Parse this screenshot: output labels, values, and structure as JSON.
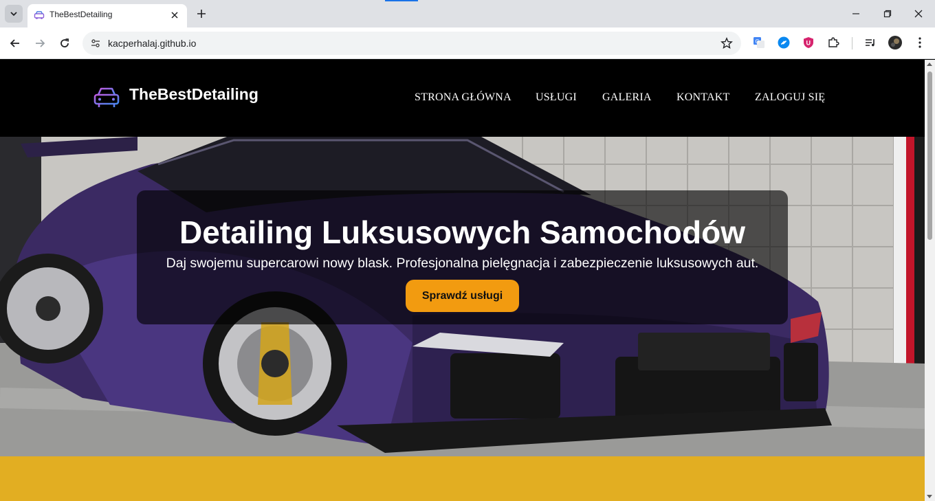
{
  "browser": {
    "tab_title": "TheBestDetailing",
    "url": "kacperhalaj.github.io"
  },
  "site": {
    "logo_text": "TheBestDetailing",
    "nav": [
      "STRONA GŁÓWNA",
      "USŁUGI",
      "GALERIA",
      "KONTAKT",
      "ZALOGUJ SIĘ"
    ]
  },
  "hero": {
    "title": "Detailing Luksusowych Samochodów",
    "subtitle": "Daj swojemu supercarowi nowy blask. Profesjonalna pielęgnacja i zabezpieczenie luksusowych aut.",
    "cta_label": "Sprawdź usługi"
  },
  "colors": {
    "header_bg": "#000000",
    "cta": "#f29b10",
    "band": "#e2ae22"
  }
}
